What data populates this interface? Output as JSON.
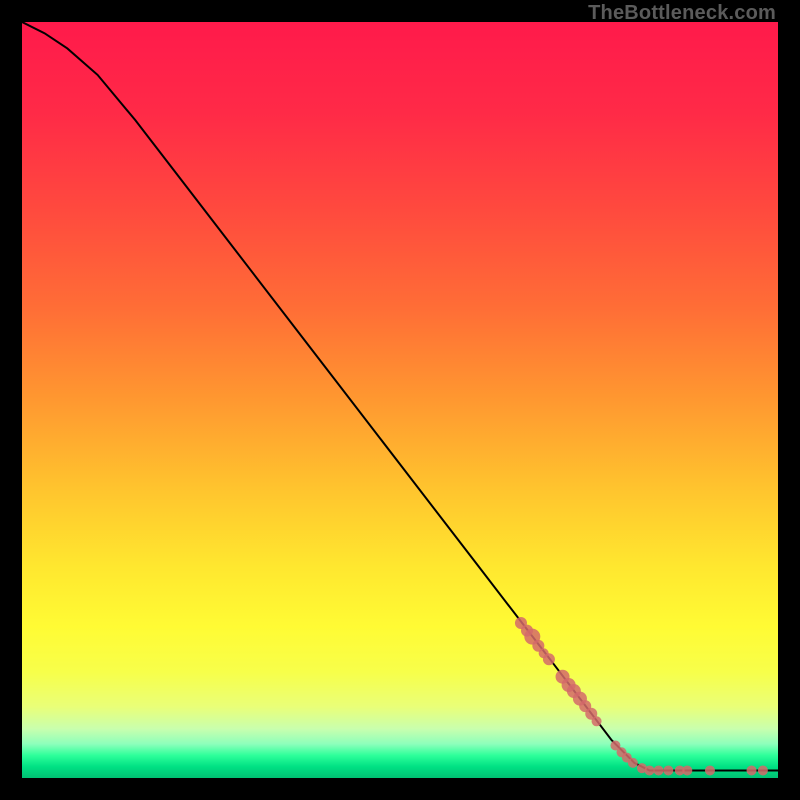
{
  "watermark": "TheBottleneck.com",
  "colors": {
    "frame": "#000000",
    "line": "#000000",
    "point": "#d46a6a",
    "gradient_stops": [
      {
        "offset": 0.0,
        "color": "#ff1a4b"
      },
      {
        "offset": 0.12,
        "color": "#ff2a47"
      },
      {
        "offset": 0.25,
        "color": "#ff4a3e"
      },
      {
        "offset": 0.38,
        "color": "#ff6e36"
      },
      {
        "offset": 0.5,
        "color": "#ff9830"
      },
      {
        "offset": 0.62,
        "color": "#ffc52e"
      },
      {
        "offset": 0.72,
        "color": "#ffe72f"
      },
      {
        "offset": 0.8,
        "color": "#fffb34"
      },
      {
        "offset": 0.86,
        "color": "#f7ff4a"
      },
      {
        "offset": 0.905,
        "color": "#eaff77"
      },
      {
        "offset": 0.935,
        "color": "#c9ffae"
      },
      {
        "offset": 0.955,
        "color": "#8dffbb"
      },
      {
        "offset": 0.97,
        "color": "#2eff9a"
      },
      {
        "offset": 0.985,
        "color": "#00e184"
      },
      {
        "offset": 1.0,
        "color": "#00c173"
      }
    ]
  },
  "chart_data": {
    "type": "line",
    "title": "",
    "xlabel": "",
    "ylabel": "",
    "xlim": [
      0,
      100
    ],
    "ylim": [
      0,
      100
    ],
    "series": [
      {
        "name": "curve",
        "points": [
          {
            "x": 0.0,
            "y": 100.0
          },
          {
            "x": 3.0,
            "y": 98.5
          },
          {
            "x": 6.0,
            "y": 96.5
          },
          {
            "x": 10.0,
            "y": 93.0
          },
          {
            "x": 15.0,
            "y": 87.0
          },
          {
            "x": 20.0,
            "y": 80.5
          },
          {
            "x": 30.0,
            "y": 67.5
          },
          {
            "x": 40.0,
            "y": 54.5
          },
          {
            "x": 50.0,
            "y": 41.5
          },
          {
            "x": 60.0,
            "y": 28.5
          },
          {
            "x": 70.0,
            "y": 15.5
          },
          {
            "x": 78.0,
            "y": 5.0
          },
          {
            "x": 81.0,
            "y": 2.0
          },
          {
            "x": 83.0,
            "y": 1.0
          },
          {
            "x": 100.0,
            "y": 1.0
          }
        ]
      }
    ],
    "scatter": [
      {
        "x": 66.0,
        "y": 20.5,
        "r": 6
      },
      {
        "x": 66.8,
        "y": 19.5,
        "r": 6
      },
      {
        "x": 67.5,
        "y": 18.7,
        "r": 8
      },
      {
        "x": 68.3,
        "y": 17.5,
        "r": 6
      },
      {
        "x": 69.0,
        "y": 16.5,
        "r": 5
      },
      {
        "x": 69.7,
        "y": 15.7,
        "r": 6
      },
      {
        "x": 71.5,
        "y": 13.4,
        "r": 7
      },
      {
        "x": 72.3,
        "y": 12.3,
        "r": 7
      },
      {
        "x": 73.0,
        "y": 11.5,
        "r": 7
      },
      {
        "x": 73.8,
        "y": 10.5,
        "r": 7
      },
      {
        "x": 74.5,
        "y": 9.5,
        "r": 6
      },
      {
        "x": 75.3,
        "y": 8.5,
        "r": 6
      },
      {
        "x": 76.0,
        "y": 7.5,
        "r": 5
      },
      {
        "x": 78.5,
        "y": 4.3,
        "r": 5
      },
      {
        "x": 79.3,
        "y": 3.4,
        "r": 5
      },
      {
        "x": 80.0,
        "y": 2.7,
        "r": 5
      },
      {
        "x": 80.8,
        "y": 2.0,
        "r": 5
      },
      {
        "x": 82.0,
        "y": 1.3,
        "r": 5
      },
      {
        "x": 83.0,
        "y": 1.0,
        "r": 5
      },
      {
        "x": 84.2,
        "y": 1.0,
        "r": 5
      },
      {
        "x": 85.5,
        "y": 1.0,
        "r": 5
      },
      {
        "x": 87.0,
        "y": 1.0,
        "r": 5
      },
      {
        "x": 88.0,
        "y": 1.0,
        "r": 5
      },
      {
        "x": 91.0,
        "y": 1.0,
        "r": 5
      },
      {
        "x": 96.5,
        "y": 1.0,
        "r": 5
      },
      {
        "x": 98.0,
        "y": 1.0,
        "r": 5
      }
    ]
  }
}
